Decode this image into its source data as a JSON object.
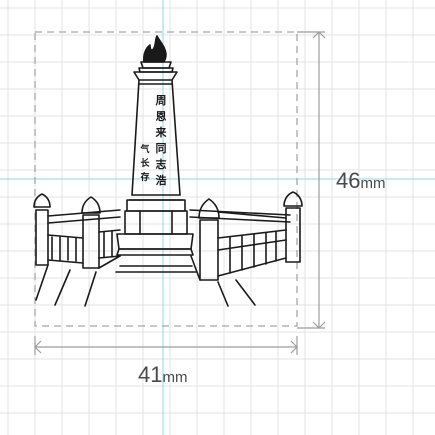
{
  "dimensions": {
    "height": {
      "value": "46",
      "unit": "mm"
    },
    "width": {
      "value": "41",
      "unit": "mm"
    }
  },
  "inscription_chars": [
    "周",
    "恩",
    "来",
    "同",
    "志",
    "浩",
    "气",
    "长",
    "存"
  ],
  "colors": {
    "background": "#ffffff",
    "grid_line": "#e3e3e3",
    "guide_line": "#8fd6ea",
    "dimension_line": "#9c9c9c",
    "dashed_box": "#a6a6a6",
    "sketch_line": "#1a1a1a",
    "label_text": "#4a4a4a"
  }
}
